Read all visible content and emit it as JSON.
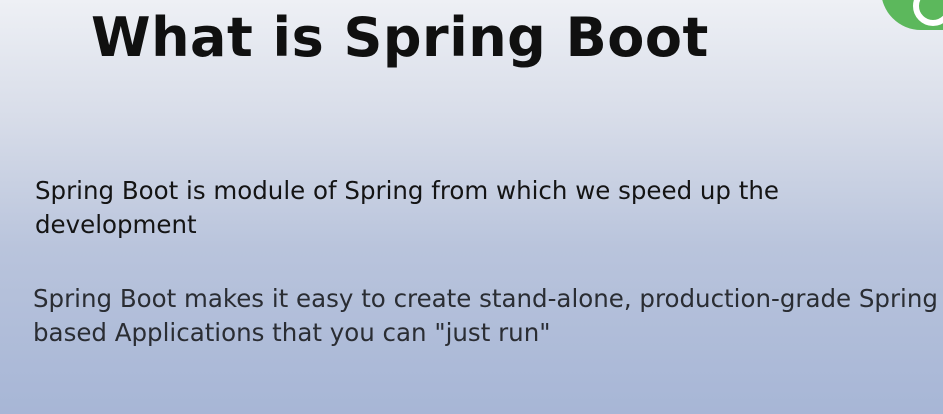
{
  "slide": {
    "title": "What is Spring Boot",
    "paragraphs": [
      "Spring Boot is module of Spring from which we speed up the development",
      "Spring Boot makes it easy to create stand-alone, production-grade Spring based Applications that you can \"just run\""
    ],
    "logo_icon": "spring-leaf-logo-icon",
    "accent_color": "#5cb85c"
  }
}
